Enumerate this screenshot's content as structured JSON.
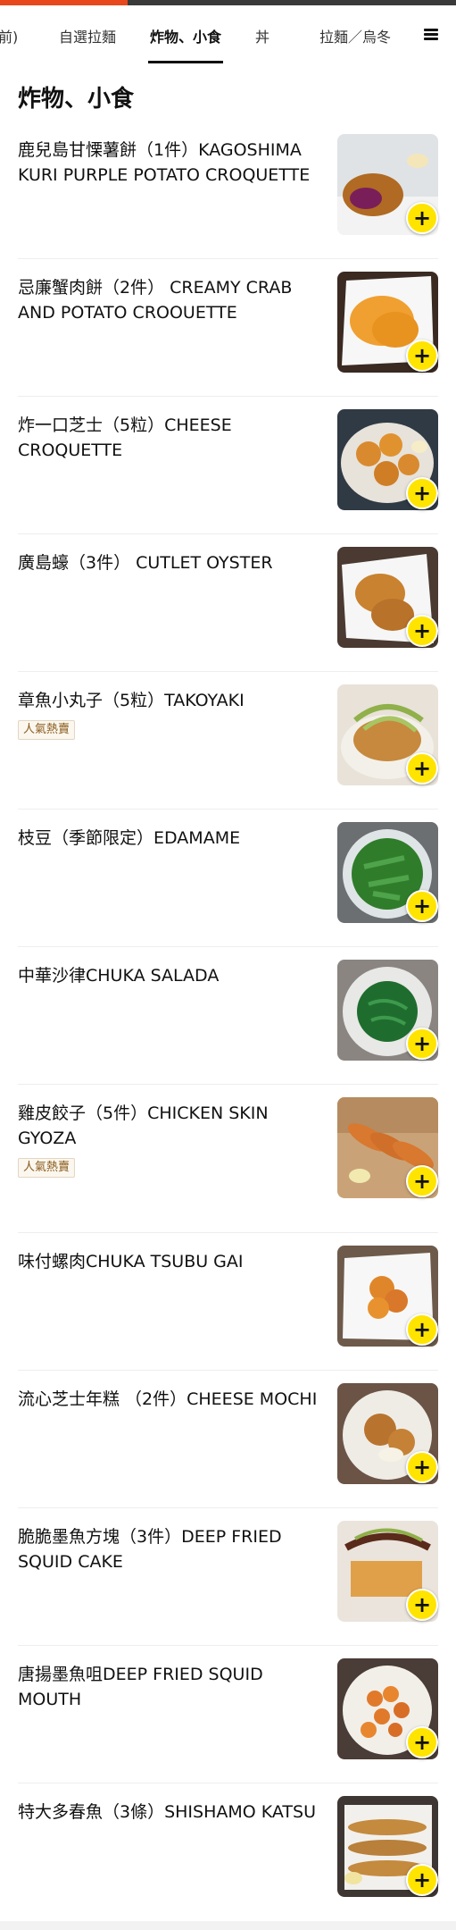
{
  "progress": 0.28,
  "tabs": [
    {
      "label": "前)",
      "active": false
    },
    {
      "label": "自選拉麵",
      "active": false
    },
    {
      "label": "炸物、小食",
      "active": true
    },
    {
      "label": "丼",
      "active": false
    },
    {
      "label": "拉麵／烏冬",
      "active": false
    }
  ],
  "section": {
    "title": "炸物、小食"
  },
  "items": [
    {
      "title": "鹿兒島甘慄薯餅（1件）KAGOSHIMA KURI PURPLE POTATO CROQUETTE",
      "badge": "",
      "image": "purple-croquette-photo"
    },
    {
      "title": "忌廉蟹肉餅（2件） CREAMY CRAB AND POTATO CROOUETTE",
      "badge": "",
      "image": "crab-croquette-photo"
    },
    {
      "title": "炸一口芝士（5粒）CHEESE CROQUETTE",
      "badge": "",
      "image": "cheese-croquette-photo"
    },
    {
      "title": "廣島蠔（3件） CUTLET OYSTER",
      "badge": "",
      "image": "oyster-photo"
    },
    {
      "title": "章魚小丸子（5粒）TAKOYAKI",
      "badge": "人氣熱賣",
      "image": "takoyaki-photo"
    },
    {
      "title": "枝豆（季節限定）EDAMAME",
      "badge": "",
      "image": "edamame-photo"
    },
    {
      "title": "中華沙律CHUKA SALADA",
      "badge": "",
      "image": "seaweed-salad-photo"
    },
    {
      "title": "雞皮餃子（5件）CHICKEN SKIN GYOZA",
      "badge": "人氣熱賣",
      "image": "gyoza-photo"
    },
    {
      "title": "味付螺肉CHUKA TSUBU GAI",
      "badge": "",
      "image": "whelk-photo"
    },
    {
      "title": "流心芝士年糕 （2件）CHEESE MOCHI",
      "badge": "",
      "image": "cheese-mochi-photo"
    },
    {
      "title": "脆脆墨魚方塊（3件）DEEP FRIED SQUID CAKE",
      "badge": "",
      "image": "squid-cake-photo"
    },
    {
      "title": "唐揚墨魚咀DEEP FRIED SQUID MOUTH",
      "badge": "",
      "image": "squid-mouth-photo"
    },
    {
      "title": "特大多春魚（3條）SHISHAMO KATSU",
      "badge": "",
      "image": "shishamo-photo"
    }
  ],
  "add_label": "+",
  "colors": {
    "accent": "#e8481c",
    "add_button": "#ffe400",
    "badge_text": "#8a5a1a"
  },
  "icons": {
    "menu": "hamburger-menu-icon"
  }
}
